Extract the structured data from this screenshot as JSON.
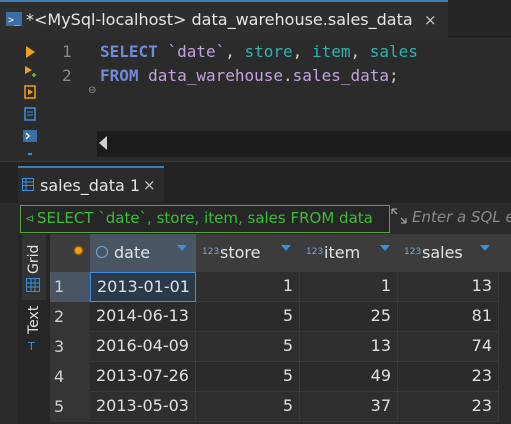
{
  "editor": {
    "tab_title": "*<MySql-localhost> data_warehouse.sales_data",
    "close": "×",
    "lines": [
      {
        "number": "1",
        "tokens": [
          {
            "t": "SELECT ",
            "c": "kw"
          },
          {
            "t": "`date`",
            "c": "tk"
          },
          {
            "t": ", ",
            "c": "pl"
          },
          {
            "t": "store",
            "c": "id"
          },
          {
            "t": ", ",
            "c": "pl"
          },
          {
            "t": "item",
            "c": "id"
          },
          {
            "t": ", ",
            "c": "pl"
          },
          {
            "t": "sales",
            "c": "id"
          }
        ]
      },
      {
        "number": "2",
        "tokens": [
          {
            "t": "FROM ",
            "c": "kw"
          },
          {
            "t": "data_warehouse",
            "c": "tk"
          },
          {
            "t": ".",
            "c": "pl"
          },
          {
            "t": "sales_data",
            "c": "tk"
          },
          {
            "t": ";",
            "c": "pl"
          }
        ]
      }
    ]
  },
  "results": {
    "tab_title": "sales_data 1",
    "close": "×",
    "filter_text": "SELECT `date`, store, item, sales FROM data",
    "filter_placeholder": "Enter a SQL e",
    "side_tabs": {
      "grid": "Grid",
      "text": "Text"
    },
    "columns": [
      {
        "type": "",
        "name": "date"
      },
      {
        "type": "123",
        "name": "store"
      },
      {
        "type": "123",
        "name": "item"
      },
      {
        "type": "123",
        "name": "sales"
      }
    ],
    "rows": [
      {
        "n": "1",
        "date": "2013-01-01",
        "store": "1",
        "item": "1",
        "sales": "13"
      },
      {
        "n": "2",
        "date": "2014-06-13",
        "store": "5",
        "item": "25",
        "sales": "81"
      },
      {
        "n": "3",
        "date": "2016-04-09",
        "store": "5",
        "item": "13",
        "sales": "74"
      },
      {
        "n": "4",
        "date": "2013-07-26",
        "store": "5",
        "item": "49",
        "sales": "23"
      },
      {
        "n": "5",
        "date": "2013-05-03",
        "store": "5",
        "item": "37",
        "sales": "23"
      }
    ]
  },
  "colors": {
    "accent": "#3c7fb1",
    "filter_green": "#3dbb3d",
    "keyword": "#6f8ad6",
    "identifier": "#2fb3ad",
    "table_token": "#c5a1e0"
  },
  "icons": [
    "sql-script-icon",
    "execute-icon",
    "execute-new-tab-icon",
    "execute-script-icon",
    "explain-plan-icon",
    "console-icon",
    "table-icon",
    "filter-icon",
    "grid-icon",
    "text-icon",
    "calendar-icon"
  ]
}
